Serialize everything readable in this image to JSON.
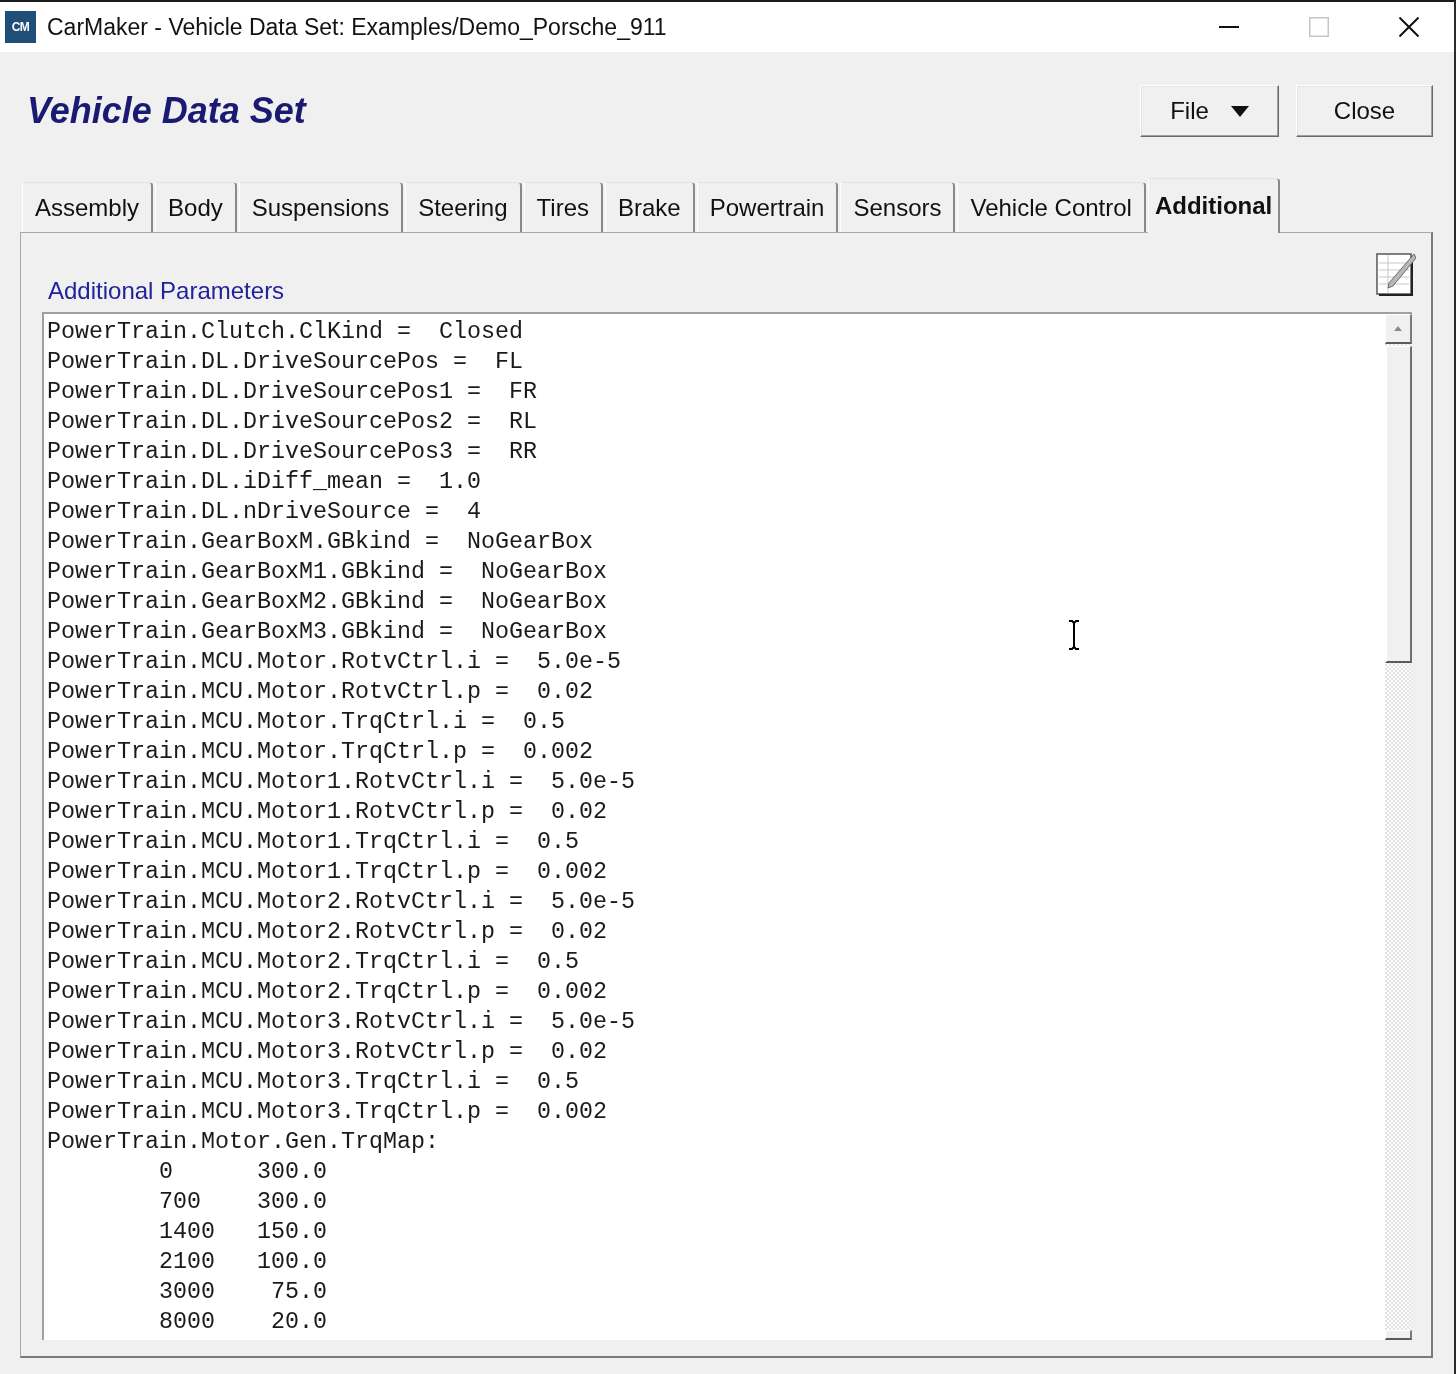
{
  "window": {
    "logo_text": "CM",
    "title": "CarMaker - Vehicle Data Set: Examples/Demo_Porsche_911",
    "controls": [
      {
        "kind": "minimize",
        "disabled": false
      },
      {
        "kind": "maximize",
        "disabled": true
      },
      {
        "kind": "close",
        "disabled": false
      }
    ]
  },
  "header": {
    "title": "Vehicle Data Set",
    "buttons": [
      {
        "label": "File",
        "kind": "menu"
      },
      {
        "label": "Close",
        "kind": "plain"
      }
    ]
  },
  "tabs": [
    {
      "label": "Assembly",
      "selected": false
    },
    {
      "label": "Body",
      "selected": false
    },
    {
      "label": "Suspensions",
      "selected": false
    },
    {
      "label": "Steering",
      "selected": false
    },
    {
      "label": "Tires",
      "selected": false
    },
    {
      "label": "Brake",
      "selected": false
    },
    {
      "label": "Powertrain",
      "selected": false
    },
    {
      "label": "Sensors",
      "selected": false
    },
    {
      "label": "Vehicle Control",
      "selected": false
    },
    {
      "label": "Additional",
      "selected": true
    }
  ],
  "panel": {
    "label": "Additional Parameters",
    "lines": [
      "PowerTrain.Clutch.ClKind =  Closed",
      "PowerTrain.DL.DriveSourcePos =  FL",
      "PowerTrain.DL.DriveSourcePos1 =  FR",
      "PowerTrain.DL.DriveSourcePos2 =  RL",
      "PowerTrain.DL.DriveSourcePos3 =  RR",
      "PowerTrain.DL.iDiff_mean =  1.0",
      "PowerTrain.DL.nDriveSource =  4",
      "PowerTrain.GearBoxM.GBkind =  NoGearBox",
      "PowerTrain.GearBoxM1.GBkind =  NoGearBox",
      "PowerTrain.GearBoxM2.GBkind =  NoGearBox",
      "PowerTrain.GearBoxM3.GBkind =  NoGearBox",
      "PowerTrain.MCU.Motor.RotvCtrl.i =  5.0e-5",
      "PowerTrain.MCU.Motor.RotvCtrl.p =  0.02",
      "PowerTrain.MCU.Motor.TrqCtrl.i =  0.5",
      "PowerTrain.MCU.Motor.TrqCtrl.p =  0.002",
      "PowerTrain.MCU.Motor1.RotvCtrl.i =  5.0e-5",
      "PowerTrain.MCU.Motor1.RotvCtrl.p =  0.02",
      "PowerTrain.MCU.Motor1.TrqCtrl.i =  0.5",
      "PowerTrain.MCU.Motor1.TrqCtrl.p =  0.002",
      "PowerTrain.MCU.Motor2.RotvCtrl.i =  5.0e-5",
      "PowerTrain.MCU.Motor2.RotvCtrl.p =  0.02",
      "PowerTrain.MCU.Motor2.TrqCtrl.i =  0.5",
      "PowerTrain.MCU.Motor2.TrqCtrl.p =  0.002",
      "PowerTrain.MCU.Motor3.RotvCtrl.i =  5.0e-5",
      "PowerTrain.MCU.Motor3.RotvCtrl.p =  0.02",
      "PowerTrain.MCU.Motor3.TrqCtrl.i =  0.5",
      "PowerTrain.MCU.Motor3.TrqCtrl.p =  0.002",
      "PowerTrain.Motor.Gen.TrqMap:"
    ],
    "map_rows": [
      {
        "column_1": "0",
        "column_2": "300.0"
      },
      {
        "column_1": "700",
        "column_2": "300.0"
      },
      {
        "column_1": "1400",
        "column_2": "150.0"
      },
      {
        "column_1": "2100",
        "column_2": "100.0"
      },
      {
        "column_1": "3000",
        "column_2": "75.0"
      },
      {
        "column_1": "8000",
        "column_2": "20.0"
      }
    ]
  }
}
